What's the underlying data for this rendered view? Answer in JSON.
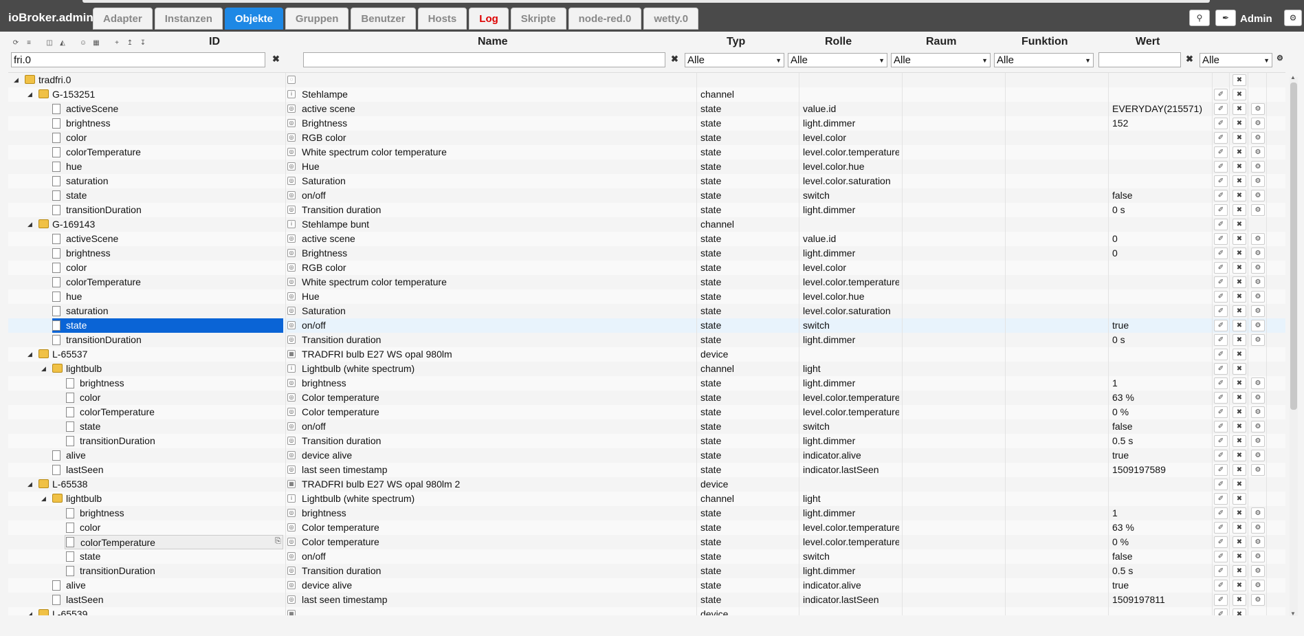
{
  "app": {
    "title": "ioBroker.admin",
    "user": "Admin"
  },
  "tabs": [
    {
      "label": "Adapter"
    },
    {
      "label": "Instanzen"
    },
    {
      "label": "Objekte",
      "active": true
    },
    {
      "label": "Gruppen"
    },
    {
      "label": "Benutzer"
    },
    {
      "label": "Hosts"
    },
    {
      "label": "Log",
      "accent": "#dd0000"
    },
    {
      "label": "Skripte"
    },
    {
      "label": "node-red.0"
    },
    {
      "label": "wetty.0"
    }
  ],
  "columns": {
    "id": "ID",
    "name": "Name",
    "typ": "Typ",
    "rolle": "Rolle",
    "raum": "Raum",
    "funktion": "Funktion",
    "wert": "Wert"
  },
  "filters": {
    "id_value": "fri.0",
    "name_value": "",
    "wert_value": "",
    "typ_select": "Alle",
    "rolle_select": "Alle",
    "raum_select": "Alle",
    "funktion_select": "Alle",
    "wert_select": "Alle"
  },
  "colors": {
    "accent": "#1e88e5",
    "selected": "#0a64d6",
    "header": "#4a4a4a"
  },
  "rows": [
    {
      "id": "tradfri.0",
      "level": 0,
      "folder": true,
      "expanded": true,
      "name": "",
      "typ": "",
      "rolle": "",
      "wert": "",
      "btns": 1
    },
    {
      "id": "G-153251",
      "level": 1,
      "folder": true,
      "expanded": true,
      "name": "Stehlampe",
      "typ": "channel",
      "rolle": "",
      "wert": "",
      "btns": 2
    },
    {
      "id": "activeScene",
      "level": 2,
      "name": "active scene",
      "typ": "state",
      "rolle": "value.id",
      "wert": "EVERYDAY(215571)",
      "btns": 3
    },
    {
      "id": "brightness",
      "level": 2,
      "name": "Brightness",
      "typ": "state",
      "rolle": "light.dimmer",
      "wert": "152",
      "btns": 3
    },
    {
      "id": "color",
      "level": 2,
      "name": "RGB color",
      "typ": "state",
      "rolle": "level.color",
      "wert": "",
      "btns": 3
    },
    {
      "id": "colorTemperature",
      "level": 2,
      "name": "White spectrum color temperature",
      "typ": "state",
      "rolle": "level.color.temperature",
      "wert": "",
      "btns": 3
    },
    {
      "id": "hue",
      "level": 2,
      "name": "Hue",
      "typ": "state",
      "rolle": "level.color.hue",
      "wert": "",
      "btns": 3
    },
    {
      "id": "saturation",
      "level": 2,
      "name": "Saturation",
      "typ": "state",
      "rolle": "level.color.saturation",
      "wert": "",
      "btns": 3
    },
    {
      "id": "state",
      "level": 2,
      "name": "on/off",
      "typ": "state",
      "rolle": "switch",
      "wert": "false",
      "btns": 3
    },
    {
      "id": "transitionDuration",
      "level": 2,
      "name": "Transition duration",
      "typ": "state",
      "rolle": "light.dimmer",
      "wert": "0 s",
      "btns": 3
    },
    {
      "id": "G-169143",
      "level": 1,
      "folder": true,
      "expanded": true,
      "name": "Stehlampe bunt",
      "typ": "channel",
      "rolle": "",
      "wert": "",
      "btns": 2
    },
    {
      "id": "activeScene",
      "level": 2,
      "name": "active scene",
      "typ": "state",
      "rolle": "value.id",
      "wert": "0",
      "btns": 3
    },
    {
      "id": "brightness",
      "level": 2,
      "name": "Brightness",
      "typ": "state",
      "rolle": "light.dimmer",
      "wert": "0",
      "btns": 3
    },
    {
      "id": "color",
      "level": 2,
      "name": "RGB color",
      "typ": "state",
      "rolle": "level.color",
      "wert": "",
      "btns": 3
    },
    {
      "id": "colorTemperature",
      "level": 2,
      "name": "White spectrum color temperature",
      "typ": "state",
      "rolle": "level.color.temperature",
      "wert": "",
      "btns": 3
    },
    {
      "id": "hue",
      "level": 2,
      "name": "Hue",
      "typ": "state",
      "rolle": "level.color.hue",
      "wert": "",
      "btns": 3
    },
    {
      "id": "saturation",
      "level": 2,
      "name": "Saturation",
      "typ": "state",
      "rolle": "level.color.saturation",
      "wert": "",
      "btns": 3
    },
    {
      "id": "state",
      "level": 2,
      "name": "on/off",
      "typ": "state",
      "rolle": "switch",
      "wert": "true",
      "btns": 3,
      "selected": true
    },
    {
      "id": "transitionDuration",
      "level": 2,
      "name": "Transition duration",
      "typ": "state",
      "rolle": "light.dimmer",
      "wert": "0 s",
      "btns": 3
    },
    {
      "id": "L-65537",
      "level": 1,
      "folder": true,
      "expanded": true,
      "name": "TRADFRI bulb E27 WS opal 980lm",
      "typ": "device",
      "rolle": "",
      "wert": "",
      "btns": 2
    },
    {
      "id": "lightbulb",
      "level": 2,
      "folder": true,
      "expanded": true,
      "name": "Lightbulb (white spectrum)",
      "typ": "channel",
      "rolle": "light",
      "wert": "",
      "btns": 2
    },
    {
      "id": "brightness",
      "level": 3,
      "name": "brightness",
      "typ": "state",
      "rolle": "light.dimmer",
      "wert": "1",
      "btns": 3
    },
    {
      "id": "color",
      "level": 3,
      "name": "Color temperature",
      "typ": "state",
      "rolle": "level.color.temperature",
      "wert": "63 %",
      "btns": 3
    },
    {
      "id": "colorTemperature",
      "level": 3,
      "name": "Color temperature",
      "typ": "state",
      "rolle": "level.color.temperature",
      "wert": "0 %",
      "btns": 3
    },
    {
      "id": "state",
      "level": 3,
      "name": "on/off",
      "typ": "state",
      "rolle": "switch",
      "wert": "false",
      "btns": 3
    },
    {
      "id": "transitionDuration",
      "level": 3,
      "name": "Transition duration",
      "typ": "state",
      "rolle": "light.dimmer",
      "wert": "0.5 s",
      "btns": 3
    },
    {
      "id": "alive",
      "level": 2,
      "name": "device alive",
      "typ": "state",
      "rolle": "indicator.alive",
      "wert": "true",
      "btns": 3
    },
    {
      "id": "lastSeen",
      "level": 2,
      "name": "last seen timestamp",
      "typ": "state",
      "rolle": "indicator.lastSeen",
      "wert": "1509197589",
      "btns": 3
    },
    {
      "id": "L-65538",
      "level": 1,
      "folder": true,
      "expanded": true,
      "name": "TRADFRI bulb E27 WS opal 980lm 2",
      "typ": "device",
      "rolle": "",
      "wert": "",
      "btns": 2
    },
    {
      "id": "lightbulb",
      "level": 2,
      "folder": true,
      "expanded": true,
      "name": "Lightbulb (white spectrum)",
      "typ": "channel",
      "rolle": "light",
      "wert": "",
      "btns": 2
    },
    {
      "id": "brightness",
      "level": 3,
      "name": "brightness",
      "typ": "state",
      "rolle": "light.dimmer",
      "wert": "1",
      "btns": 3
    },
    {
      "id": "color",
      "level": 3,
      "name": "Color temperature",
      "typ": "state",
      "rolle": "level.color.temperature",
      "wert": "63 %",
      "btns": 3
    },
    {
      "id": "colorTemperature",
      "level": 3,
      "name": "Color temperature",
      "typ": "state",
      "rolle": "level.color.temperature",
      "wert": "0 %",
      "btns": 3,
      "hover": true
    },
    {
      "id": "state",
      "level": 3,
      "name": "on/off",
      "typ": "state",
      "rolle": "switch",
      "wert": "false",
      "btns": 3
    },
    {
      "id": "transitionDuration",
      "level": 3,
      "name": "Transition duration",
      "typ": "state",
      "rolle": "light.dimmer",
      "wert": "0.5 s",
      "btns": 3
    },
    {
      "id": "alive",
      "level": 2,
      "name": "device alive",
      "typ": "state",
      "rolle": "indicator.alive",
      "wert": "true",
      "btns": 3
    },
    {
      "id": "lastSeen",
      "level": 2,
      "name": "last seen timestamp",
      "typ": "state",
      "rolle": "indicator.lastSeen",
      "wert": "1509197811",
      "btns": 3
    },
    {
      "id": "L-65539",
      "level": 1,
      "folder": true,
      "expanded": true,
      "name": "",
      "typ": "device",
      "rolle": "",
      "wert": "",
      "btns": 2
    }
  ]
}
